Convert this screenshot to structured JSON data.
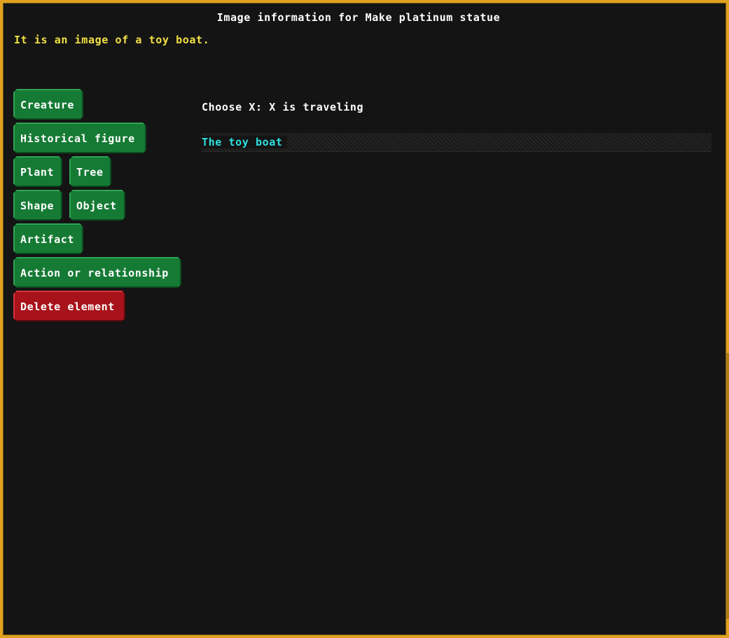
{
  "window": {
    "title": "Image information for Make platinum statue",
    "description": "It is an image of a toy boat."
  },
  "element_buttons": [
    {
      "label": "Creature"
    },
    {
      "label": "Historical figure"
    },
    {
      "label": "Plant"
    },
    {
      "label": "Tree"
    },
    {
      "label": "Shape"
    },
    {
      "label": "Object"
    },
    {
      "label": "Artifact"
    },
    {
      "label": "Action or relationship"
    },
    {
      "label": "Delete element"
    }
  ],
  "chooser": {
    "prompt": "Choose X: X is traveling",
    "options": [
      {
        "label": "The toy boat"
      }
    ]
  },
  "colors": {
    "frame": "#e0a020",
    "button_green": "#157a34",
    "button_red": "#a8121a",
    "description_text": "#f2e044",
    "option_text": "#2ee0e0"
  }
}
